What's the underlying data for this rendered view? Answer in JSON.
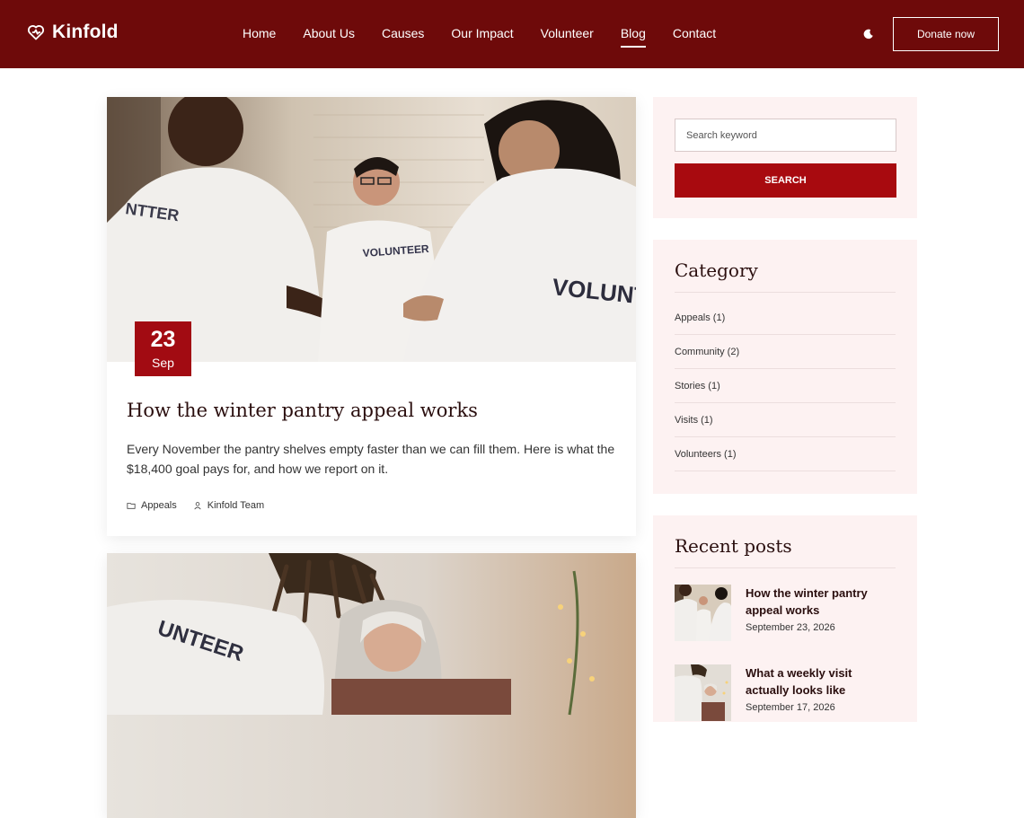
{
  "header": {
    "logo_text": "Kinfold",
    "nav": [
      {
        "label": "Home"
      },
      {
        "label": "About Us"
      },
      {
        "label": "Causes"
      },
      {
        "label": "Our Impact"
      },
      {
        "label": "Volunteer"
      },
      {
        "label": "Blog",
        "active": true
      },
      {
        "label": "Contact"
      }
    ],
    "donate_label": "Donate now",
    "colors": {
      "header_bg": "#6e0a0a",
      "accent": "#a20b12"
    }
  },
  "posts": [
    {
      "day": "23",
      "month": "Sep",
      "title": "How the winter pantry appeal works",
      "excerpt": "Every November the pantry shelves empty faster than we can fill them. Here is what the $18,400 goal pays for, and how we report on it.",
      "category": "Appeals",
      "author": "Kinfold Team"
    },
    {
      "title": "What a weekly visit actually looks like"
    }
  ],
  "sidebar": {
    "search": {
      "placeholder": "Search keyword",
      "button_label": "SEARCH"
    },
    "category": {
      "title": "Category",
      "items": [
        {
          "label": "Appeals (1)"
        },
        {
          "label": "Community (2)"
        },
        {
          "label": "Stories (1)"
        },
        {
          "label": "Visits (1)"
        },
        {
          "label": "Volunteers (1)"
        }
      ]
    },
    "recent": {
      "title": "Recent posts",
      "items": [
        {
          "title": "How the winter pantry appeal works",
          "date": "September 23, 2026"
        },
        {
          "title": "What a weekly visit actually looks like",
          "date": "September 17, 2026"
        }
      ]
    }
  }
}
